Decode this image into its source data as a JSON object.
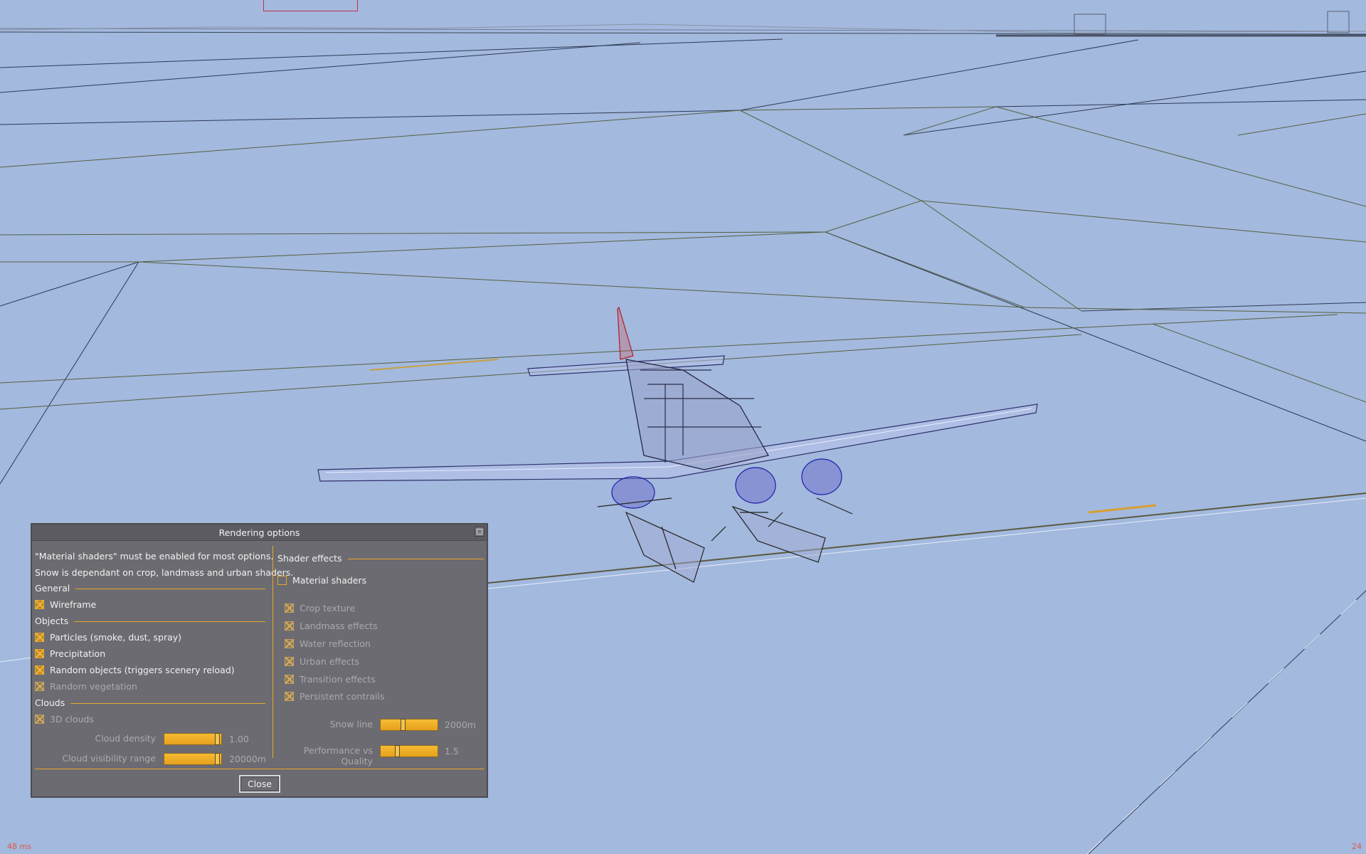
{
  "dialog": {
    "title": "Rendering options",
    "note_1": "\"Material shaders\" must be enabled for most options.",
    "note_2": "Snow is dependant on crop, landmass and urban shaders.",
    "general": {
      "heading": "General",
      "wireframe": "Wireframe"
    },
    "objects": {
      "heading": "Objects",
      "particles": "Particles (smoke, dust, spray)",
      "precipitation": "Precipitation",
      "random_objects": "Random objects (triggers scenery reload)",
      "random_vegetation": "Random vegetation"
    },
    "clouds": {
      "heading": "Clouds",
      "clouds_3d": "3D clouds",
      "cloud_density_label": "Cloud density",
      "cloud_density_value": "1.00",
      "cloud_density_level": 0.97,
      "cloud_visibility_label": "Cloud visibility range",
      "cloud_visibility_value": "20000m",
      "cloud_visibility_level": 0.97
    },
    "shader_effects": {
      "heading": "Shader effects",
      "material_shaders": "Material shaders",
      "crop_texture": "Crop texture",
      "landmass_effects": "Landmass effects",
      "water_reflection": "Water reflection",
      "urban_effects": "Urban effects",
      "transition_effects": "Transition effects",
      "persistent_contrails": "Persistent contrails",
      "snow_line_label": "Snow line",
      "snow_line_value": "2000m",
      "snow_line_level": 0.38,
      "performance_label": "Performance vs Quality",
      "performance_value": "1.5",
      "performance_level": 0.28
    },
    "close_label": "Close"
  },
  "checkbox_states": {
    "wireframe": true,
    "particles": true,
    "precipitation": true,
    "random_objects": true,
    "random_vegetation": true,
    "clouds_3d": true,
    "material_shaders": false,
    "crop_texture": true,
    "landmass_effects": true,
    "water_reflection": true,
    "urban_effects": true,
    "transition_effects": true,
    "persistent_contrails": true
  },
  "hud": {
    "frame_ms": "48 ms",
    "frame_rate": "24"
  },
  "colors": {
    "sky": "#a3b9de",
    "accent": "#e8a62a",
    "dialog_bg": "#6b6b71",
    "hud": "#e0584a"
  }
}
